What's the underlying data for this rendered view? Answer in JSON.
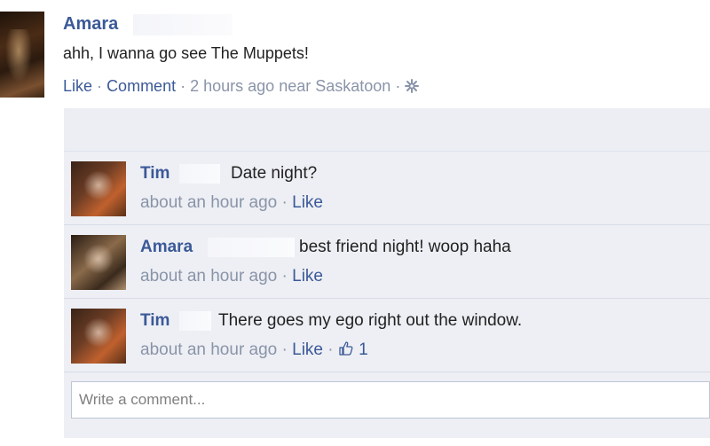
{
  "post": {
    "author": "Amara",
    "message": "ahh, I wanna go see The Muppets!",
    "like_link": "Like",
    "comment_link": "Comment",
    "separator": "·",
    "time_location": "2 hours ago near Saskatoon",
    "settings_icon": "gear-icon"
  },
  "comments": [
    {
      "author": "Tim",
      "text": "Date night?",
      "time": "about an hour ago",
      "like_link": "Like",
      "like_count": ""
    },
    {
      "author": "Amara",
      "text": "best friend night! woop haha",
      "time": "about an hour ago",
      "like_link": "Like",
      "like_count": ""
    },
    {
      "author": "Tim",
      "text": "There goes my ego right out the window.",
      "time": "about an hour ago",
      "like_link": "Like",
      "like_count": "1",
      "like_icon": "thumbs-up-icon"
    }
  ],
  "comment_input": {
    "placeholder": "Write a comment..."
  },
  "colors": {
    "link": "#3b5998",
    "meta": "#8a94a8",
    "comment_bg": "#edeff4"
  }
}
